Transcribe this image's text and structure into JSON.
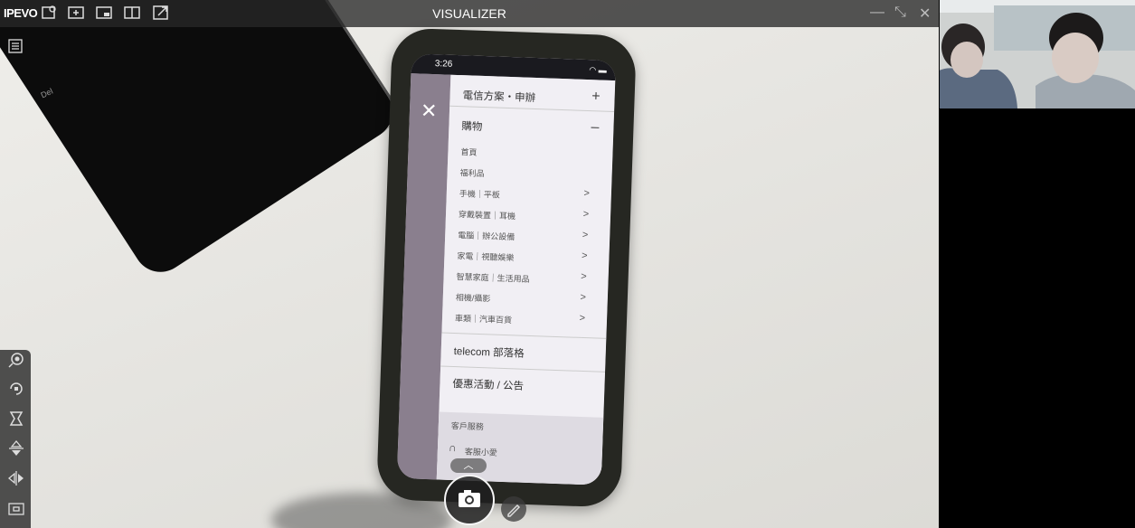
{
  "app": {
    "logo": "IPEVO",
    "title": "VISUALIZER"
  },
  "phone": {
    "status_time": "3:26",
    "menu": {
      "header": "電信方案・申辦",
      "section": "購物",
      "items": [
        "首頁",
        "福利品",
        "手機｜平板",
        "穿戴裝置｜耳機",
        "電腦｜辦公設備",
        "家電｜視聽娛樂",
        "智慧家庭｜生活用品",
        "相機/攝影",
        "車類｜汽車百貨"
      ],
      "blog": "telecom 部落格",
      "promo": "優惠活動 / 公告",
      "service_header": "客戶服務",
      "service_item": "客服小愛"
    }
  },
  "tablet_label": "Del",
  "colors": {
    "toolbar_bg": "#282828",
    "accent": "#ffffff"
  },
  "icons": {
    "top": [
      "settings-icon",
      "add-window-icon",
      "picture-in-picture-icon",
      "split-view-icon",
      "external-icon"
    ],
    "left": [
      "zoom-icon",
      "rotate-icon",
      "freeze-icon",
      "flip-vertical-icon",
      "mirror-icon",
      "fit-screen-icon"
    ]
  }
}
